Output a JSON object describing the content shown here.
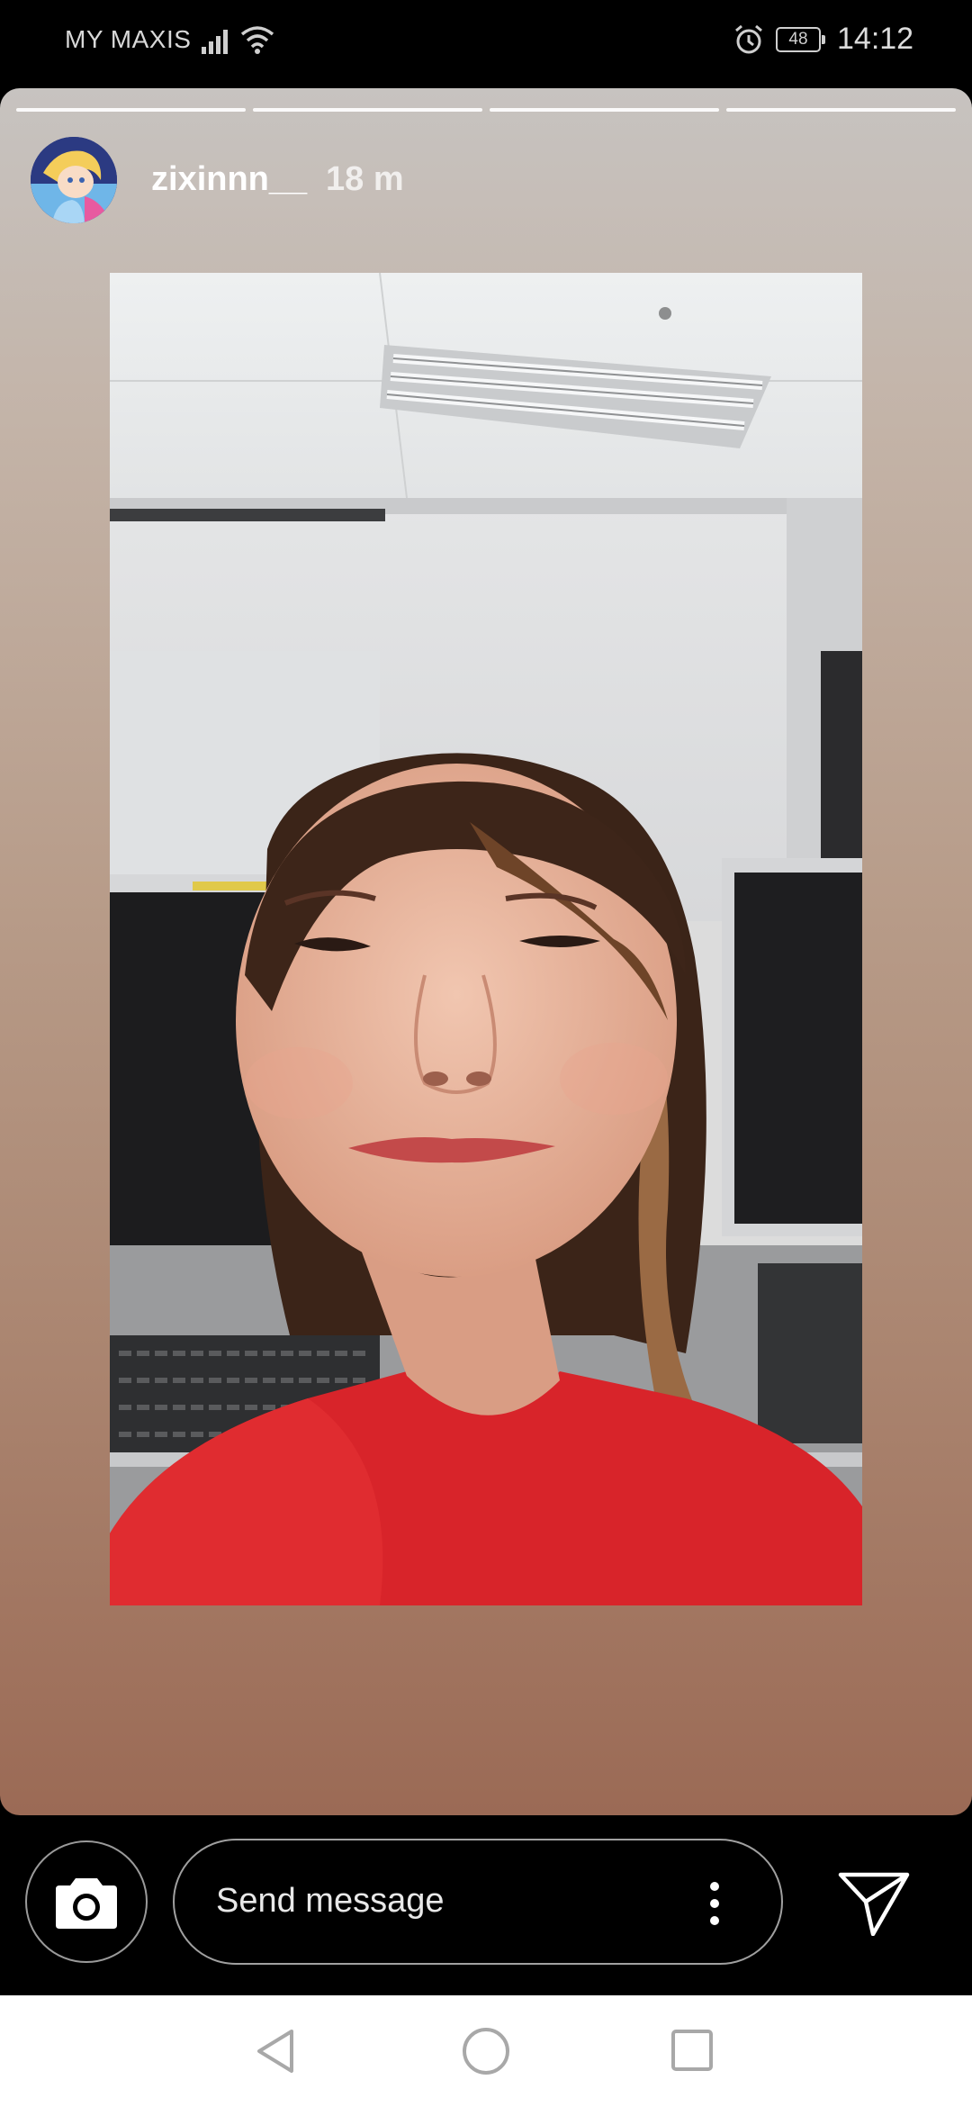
{
  "status_bar": {
    "carrier": "MY MAXIS",
    "battery": "48",
    "time": "14:12",
    "icons": [
      "signal-icon",
      "wifi-icon",
      "alarm-icon",
      "battery-icon"
    ]
  },
  "story": {
    "segments": 4,
    "username": "zixinnn__",
    "time_ago": "18 m",
    "background_top": "#c7c3c0",
    "background_bottom": "#9b6a55"
  },
  "reply": {
    "placeholder": "Send message",
    "icons": [
      "camera-icon",
      "more-vertical-icon",
      "send-icon"
    ]
  },
  "nav": {
    "icons": [
      "back-icon",
      "home-icon",
      "recents-icon"
    ]
  }
}
